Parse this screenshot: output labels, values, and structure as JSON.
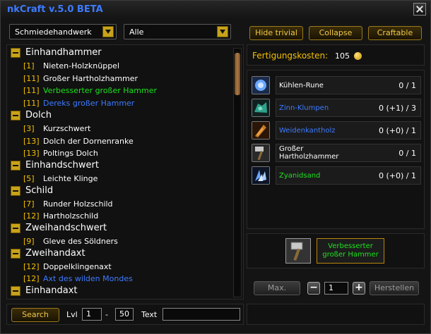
{
  "title": "nkCraft v.5.0 BETA",
  "profession_dropdown": "Schmiedehandwerk",
  "filter_dropdown": "Alle",
  "buttons": {
    "hide_trivial": "Hide trivial",
    "collapse": "Collapse",
    "craftable": "Craftable"
  },
  "recipes": [
    {
      "type": "cat",
      "name": "Einhandhammer"
    },
    {
      "type": "item",
      "level": "[1]",
      "name": "Nieten-Holzknüppel",
      "color": "white"
    },
    {
      "type": "item",
      "level": "[11]",
      "name": "Großer Hartholzhammer",
      "color": "white"
    },
    {
      "type": "item",
      "level": "[11]",
      "name": "Verbesserter großer Hammer",
      "color": "green"
    },
    {
      "type": "item",
      "level": "[11]",
      "name": "Dereks großer Hammer",
      "color": "blue"
    },
    {
      "type": "cat",
      "name": "Dolch"
    },
    {
      "type": "item",
      "level": "[3]",
      "name": "Kurzschwert",
      "color": "white"
    },
    {
      "type": "item",
      "level": "[13]",
      "name": "Dolch der Dornenranke",
      "color": "white"
    },
    {
      "type": "item",
      "level": "[13]",
      "name": "Poltings Dolch",
      "color": "white"
    },
    {
      "type": "cat",
      "name": "Einhandschwert"
    },
    {
      "type": "item",
      "level": "[5]",
      "name": "Leichte Klinge",
      "color": "white"
    },
    {
      "type": "cat",
      "name": "Schild"
    },
    {
      "type": "item",
      "level": "[7]",
      "name": "Runder Holzschild",
      "color": "white"
    },
    {
      "type": "item",
      "level": "[12]",
      "name": "Hartholzschild",
      "color": "white"
    },
    {
      "type": "cat",
      "name": "Zweihandschwert"
    },
    {
      "type": "item",
      "level": "[9]",
      "name": "Gleve des Söldners",
      "color": "white"
    },
    {
      "type": "cat",
      "name": "Zweihandaxt"
    },
    {
      "type": "item",
      "level": "[12]",
      "name": "Doppelklingenaxt",
      "color": "white"
    },
    {
      "type": "item",
      "level": "[12]",
      "name": "Axt des wilden Mondes",
      "color": "blue"
    },
    {
      "type": "cat",
      "name": "Einhandaxt"
    }
  ],
  "cost": {
    "label": "Fertigungskosten:",
    "value": "105"
  },
  "reagents": [
    {
      "name": "Kühlen-Rune",
      "count": "0 / 1",
      "color": "white",
      "icon": "rune-icon"
    },
    {
      "name": "Zinn-Klumpen",
      "count": "0 (+1) / 3",
      "color": "blue",
      "icon": "ore-icon"
    },
    {
      "name": "Weidenkantholz",
      "count": "0 (+0) / 1",
      "color": "blue",
      "icon": "wood-icon"
    },
    {
      "name": "Großer Hartholzhammer",
      "count": "0 / 1",
      "color": "white",
      "icon": "hammer-icon"
    },
    {
      "name": "Zyanidsand",
      "count": "0 (+0) / 1",
      "color": "green",
      "icon": "sand-icon"
    }
  ],
  "result": {
    "name": "Verbesserter großer Hammer"
  },
  "controls": {
    "max": "Max.",
    "qty": "1",
    "herstellen": "Herstellen"
  },
  "search": {
    "button": "Search",
    "lvl_label": "Lvl",
    "lvl_min": "1",
    "dash": "-",
    "lvl_max": "50",
    "text_label": "Text",
    "text_value": ""
  },
  "colors": {
    "accent": "#f5c000",
    "title": "#3d7bff",
    "green": "#1fe21f",
    "blue": "#3d7bff"
  }
}
